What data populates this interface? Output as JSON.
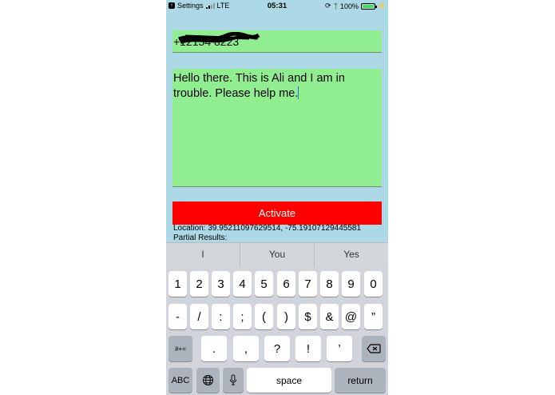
{
  "status_bar": {
    "back_label": "Settings",
    "carrier": "LTE",
    "time": "05:31",
    "battery_pct": "100%",
    "battery_level": 1.0
  },
  "phone_field": {
    "value": "+12154 8223"
  },
  "message_field": {
    "value": "Hello there. This is Ali and I am in trouble. Please help me."
  },
  "activate_button": {
    "label": "Activate"
  },
  "location": {
    "text": "Location: 39.95211097629514, -75.19107129445581"
  },
  "partial_results": {
    "text": "Partial Results:"
  },
  "predictions": [
    "I",
    "You",
    "Yes"
  ],
  "keyboard": {
    "row1": [
      "1",
      "2",
      "3",
      "4",
      "5",
      "6",
      "7",
      "8",
      "9",
      "0"
    ],
    "row2": [
      "-",
      "/",
      ":",
      ";",
      "(",
      ")",
      "$",
      "&",
      "@",
      "”"
    ],
    "row3": [
      ".",
      ",",
      "?",
      "!",
      "’"
    ],
    "symbols_key": "#+=",
    "abc_key": "ABC",
    "space_key": "space",
    "return_key": "return"
  },
  "colors": {
    "background": "#add8e6",
    "field": "#90ee90",
    "button": "#ff0000"
  }
}
